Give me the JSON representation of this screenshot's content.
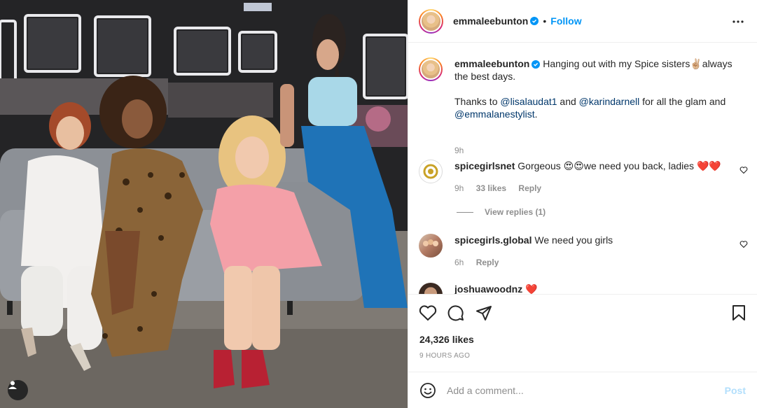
{
  "photo": {
    "alt_icon": "user-tag-icon"
  },
  "header": {
    "username": "emmaleebunton",
    "separator": "•",
    "follow_label": "Follow"
  },
  "caption": {
    "username": "emmaleebunton",
    "text_1": "Hanging out with my Spice sisters",
    "emoji_1": "✌🏼",
    "text_2": "always the best days.",
    "thanks_prefix": "Thanks to ",
    "mention_1": "@lisalaudat1",
    "and_text": " and ",
    "mention_2": "@karindarnell",
    "mid_text": " for all the glam and ",
    "mention_3": "@emmalanestylist",
    "end_text": ".",
    "time": "9h"
  },
  "comments": [
    {
      "username": "spicegirlsnet",
      "text_1": "Gorgeous ",
      "emoji_1": "😍😍",
      "text_2": "we need you back, ladies ",
      "emoji_2": "❤️❤️",
      "time": "9h",
      "likes": "33 likes",
      "reply": "Reply",
      "view_replies": "View replies (1)"
    },
    {
      "username": "spicegirls.global",
      "text": "We need you girls",
      "time": "6h",
      "reply": "Reply"
    },
    {
      "username": "joshuawoodnz",
      "emoji": "❤️"
    }
  ],
  "actions": {
    "likes": "24,326 likes",
    "timestamp": "9 HOURS AGO",
    "comment_placeholder": "Add a comment...",
    "post_label": "Post"
  },
  "colors": {
    "accent": "#0095f6",
    "mention": "#00376b",
    "muted": "#8e8e8e",
    "post_disabled": "#b2dffc"
  }
}
